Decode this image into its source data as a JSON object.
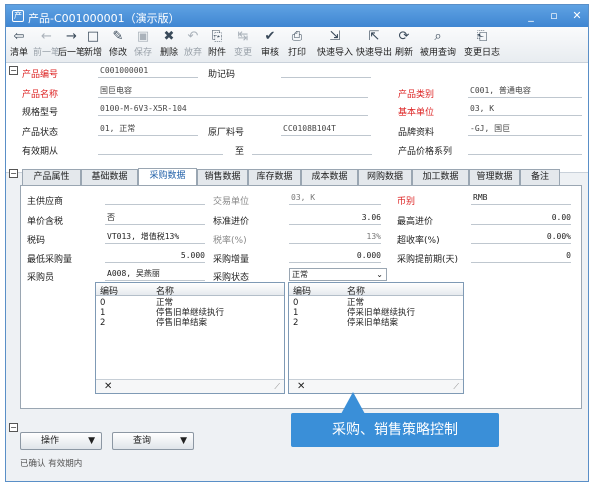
{
  "window": {
    "title": "产品-C001000001（演示版）",
    "logo": "产"
  },
  "toolbar": [
    {
      "label": "清单",
      "icon": "⇦",
      "enabled": true
    },
    {
      "label": "前一笔",
      "icon": "←",
      "enabled": false
    },
    {
      "label": "后一笔",
      "icon": "→",
      "enabled": true
    },
    {
      "label": "新增",
      "icon": "□",
      "enabled": true
    },
    {
      "label": "修改",
      "icon": "✎",
      "enabled": true
    },
    {
      "label": "保存",
      "icon": "▣",
      "enabled": false
    },
    {
      "label": "删除",
      "icon": "✖",
      "enabled": true
    },
    {
      "label": "放弃",
      "icon": "↶",
      "enabled": false
    },
    {
      "label": "附件",
      "icon": "⎘",
      "enabled": true
    },
    {
      "label": "变更",
      "icon": "↹",
      "enabled": false
    },
    {
      "label": "审核",
      "icon": "✔",
      "enabled": true
    },
    {
      "label": "打印",
      "icon": "⎙",
      "enabled": true
    },
    {
      "label": "快速导入",
      "icon": "⇲",
      "enabled": true
    },
    {
      "label": "快速导出",
      "icon": "⇱",
      "enabled": true
    },
    {
      "label": "刷新",
      "icon": "⟳",
      "enabled": true
    },
    {
      "label": "被用查询",
      "icon": "⌕",
      "enabled": true
    },
    {
      "label": "变更日志",
      "icon": "⎗",
      "enabled": true
    }
  ],
  "form": {
    "product_code_label": "产品编号",
    "product_code": "C001000001",
    "mnemonic_label": "助记码",
    "product_name_label": "产品名称",
    "product_name": "国巨电容",
    "category_label": "产品类别",
    "category": "C001, 普通电容",
    "spec_label": "规格型号",
    "spec": "0100-M-6V3-X5R-104",
    "unit_label": "基本单位",
    "unit": "03, K",
    "status_label": "产品状态",
    "status": "01, 正常",
    "orig_part_label": "原厂料号",
    "orig_part": "CC0108B104T",
    "brand_label": "品牌资料",
    "brand": "-GJ, 国巨",
    "validity_label": "有效期从",
    "validity_to": "至",
    "price_series_label": "产品价格系列"
  },
  "tabs": [
    "产品属性",
    "基础数据",
    "采购数据",
    "销售数据",
    "库存数据",
    "成本数据",
    "网购数据",
    "加工数据",
    "管理数据",
    "备注"
  ],
  "purchase": {
    "supplier_label": "主供应商",
    "trade_unit_label": "交易单位",
    "trade_unit": "03, K",
    "currency_label": "币别",
    "currency": "RMB",
    "tax_included_label": "单价含税",
    "tax_included": "否",
    "std_price_label": "标准进价",
    "std_price": "3.06",
    "max_price_label": "最高进价",
    "max_price": "0.00",
    "tax_label": "税码",
    "tax": "VT013, 增值税13%",
    "tax_rate_label": "税率(%)",
    "tax_rate": "13%",
    "over_rate_label": "超收率(%)",
    "over_rate": "0.00%",
    "min_qty_label": "最低采购量",
    "min_qty": "5.000",
    "increment_label": "采购增量",
    "increment": "0.000",
    "lead_label": "采购提前期(天)",
    "lead": "0",
    "buyer_label": "采购员",
    "buyer": "A008, 吴燕丽",
    "policy_label": "采购状态",
    "policy": "正常"
  },
  "left_list": {
    "headers": [
      "编码",
      "名称"
    ],
    "rows": [
      [
        "0",
        "正常"
      ],
      [
        "1",
        "停售旧单继续执行"
      ],
      [
        "2",
        "停售旧单结案"
      ]
    ]
  },
  "right_list": {
    "headers": [
      "编码",
      "名称"
    ],
    "rows": [
      [
        "0",
        "正常"
      ],
      [
        "1",
        "停采旧单继续执行"
      ],
      [
        "2",
        "停采旧单结案"
      ]
    ]
  },
  "tooltip": "采购、销售策略控制",
  "actions": {
    "operate": "操作",
    "query": "查询"
  },
  "status_bar": "已确认 有效期内"
}
